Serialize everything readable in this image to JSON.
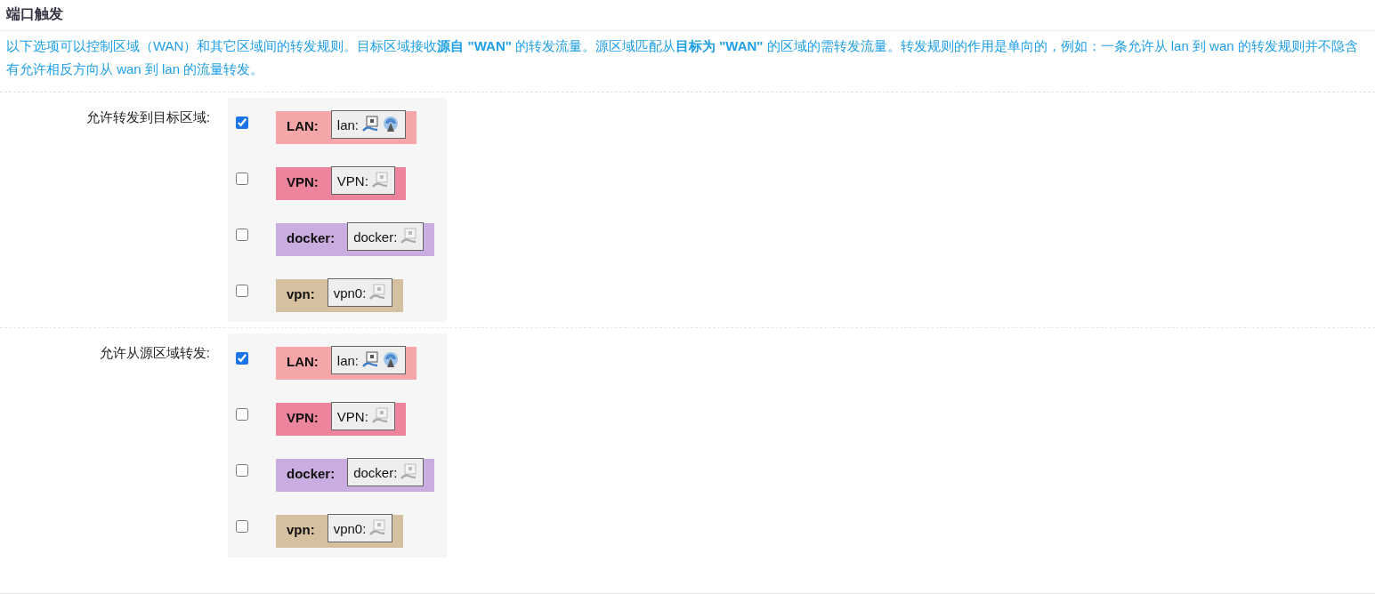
{
  "section": {
    "title": "端口触发",
    "description": "以下选项可以控制区域（WAN）和其它区域间的转发规则。目标区域接收**源自 \"WAN\"** 的转发流量。源区域匹配从**目标为 \"WAN\"** 的区域的需转发流量。转发规则的作用是单向的，例如：一条允许从 lan 到 wan 的转发规则并不隐含有允许相反方向从 wan 到 lan 的流量转发。"
  },
  "fields": [
    {
      "label": "允许转发到目标区域:",
      "zones": [
        {
          "name": "LAN:",
          "color": "#f5a6a8",
          "checked": true,
          "interface": "lan:",
          "devices": [
            {
              "kind": "wired",
              "active": true
            },
            {
              "kind": "wireless",
              "active": true
            }
          ]
        },
        {
          "name": "VPN:",
          "color": "#ec849c",
          "checked": false,
          "interface": "VPN:",
          "devices": [
            {
              "kind": "wired",
              "active": false
            }
          ]
        },
        {
          "name": "docker:",
          "color": "#c9ade0",
          "checked": false,
          "interface": "docker:",
          "devices": [
            {
              "kind": "wired",
              "active": false
            }
          ]
        },
        {
          "name": "vpn:",
          "color": "#d5c1a0",
          "checked": false,
          "interface": "vpn0:",
          "devices": [
            {
              "kind": "wired",
              "active": false
            }
          ]
        }
      ]
    },
    {
      "label": "允许从源区域转发:",
      "zones": [
        {
          "name": "LAN:",
          "color": "#f5a6a8",
          "checked": true,
          "interface": "lan:",
          "devices": [
            {
              "kind": "wired",
              "active": true
            },
            {
              "kind": "wireless",
              "active": true
            }
          ]
        },
        {
          "name": "VPN:",
          "color": "#ec849c",
          "checked": false,
          "interface": "VPN:",
          "devices": [
            {
              "kind": "wired",
              "active": false
            }
          ]
        },
        {
          "name": "docker:",
          "color": "#c9ade0",
          "checked": false,
          "interface": "docker:",
          "devices": [
            {
              "kind": "wired",
              "active": false
            }
          ]
        },
        {
          "name": "vpn:",
          "color": "#d5c1a0",
          "checked": false,
          "interface": "vpn0:",
          "devices": [
            {
              "kind": "wired",
              "active": false
            }
          ]
        }
      ]
    }
  ]
}
